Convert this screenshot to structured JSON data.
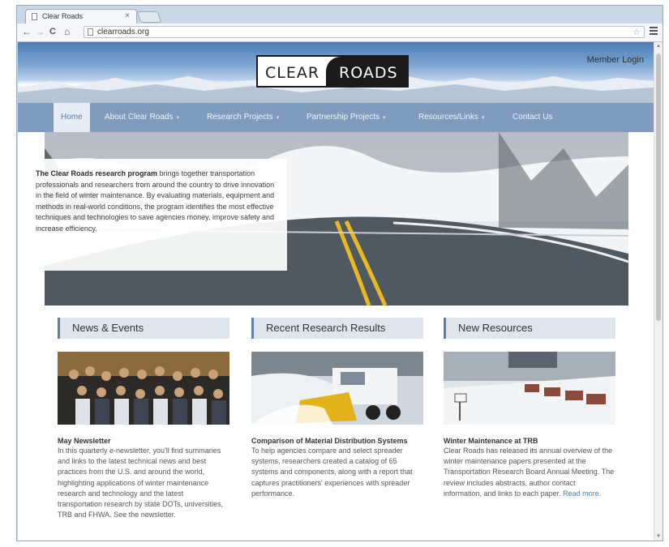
{
  "browser": {
    "tab_title": "Clear Roads",
    "tab_close": "×",
    "url": "clearroads.org",
    "back": "←",
    "forward": "→",
    "reload": "C",
    "home": "⌂"
  },
  "header": {
    "logo_left": "CLEAR",
    "logo_right": "ROADS",
    "member_login": "Member Login"
  },
  "nav": {
    "items": [
      {
        "label": "Home"
      },
      {
        "label": "About Clear Roads"
      },
      {
        "label": "Research Projects"
      },
      {
        "label": "Partnership Projects"
      },
      {
        "label": "Resources/Links"
      },
      {
        "label": "Contact Us"
      }
    ],
    "caret": "▾"
  },
  "hero": {
    "lead": "The Clear Roads research program",
    "body": " brings together transportation professionals and researchers from around the country to drive innovation in the field of winter maintenance. By evaluating materials, equipment and methods in real-world conditions, the program identifies the most effective techniques and technologies to save agencies money, improve safety and increase efficiency."
  },
  "columns": [
    {
      "heading": "News & Events",
      "title": "May Newsletter",
      "text": "In this quarterly e-newsletter, you'll find summaries and links to the latest technical news and best practices from the U.S. and around the world, highlighting applications of winter maintenance research and technology and the latest transportation research by state DOTs, universities, TRB and FHWA. See the newsletter."
    },
    {
      "heading": "Recent Research Results",
      "title": "Comparison of Material Distribution Systems",
      "text": "To help agencies compare and select spreader systems, researchers created a catalog of 65 systems and components, along with a report that captures practitioners' experiences with spreader performance."
    },
    {
      "heading": "New Resources",
      "title": "Winter Maintenance at TRB",
      "text": "Clear Roads has released its annual overview of the winter maintenance papers presented at the Transportation Research Board Annual Meeting. The review includes abstracts, author contact information, and links to each paper.",
      "read_more": "Read more."
    }
  ],
  "colors": {
    "nav_bg": "#7f9bbe",
    "nav_active_bg": "#e6ecf3",
    "heading_bar": "#dfe5ec",
    "link": "#4d7fbf"
  }
}
